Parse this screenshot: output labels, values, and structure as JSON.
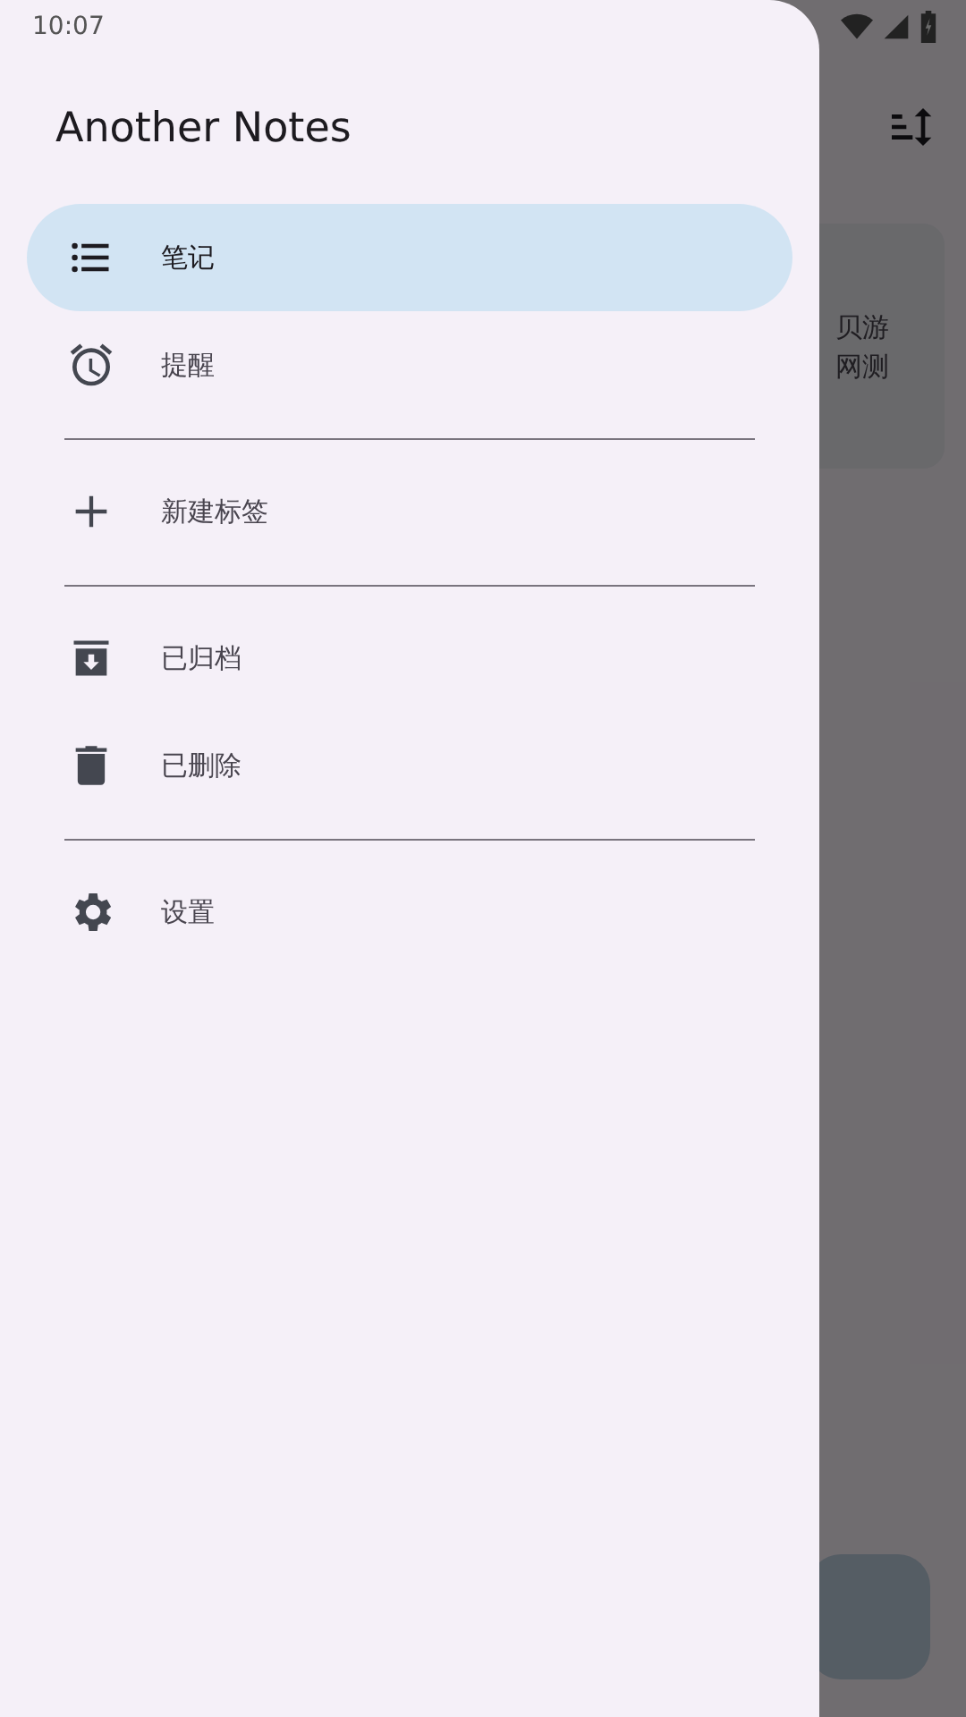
{
  "status_bar": {
    "time": "10:07"
  },
  "background": {
    "note_lines": [
      "贝游",
      "网测"
    ]
  },
  "drawer": {
    "title": "Another Notes",
    "entries": [
      {
        "kind": "item",
        "label": "笔记",
        "selected": true
      },
      {
        "kind": "item",
        "label": "提醒",
        "selected": false
      },
      {
        "kind": "divider"
      },
      {
        "kind": "item",
        "label": "新建标签",
        "selected": false
      },
      {
        "kind": "divider"
      },
      {
        "kind": "item",
        "label": "已归档",
        "selected": false
      },
      {
        "kind": "item",
        "label": "已删除",
        "selected": false
      },
      {
        "kind": "divider"
      },
      {
        "kind": "item",
        "label": "设置",
        "selected": false
      }
    ]
  }
}
